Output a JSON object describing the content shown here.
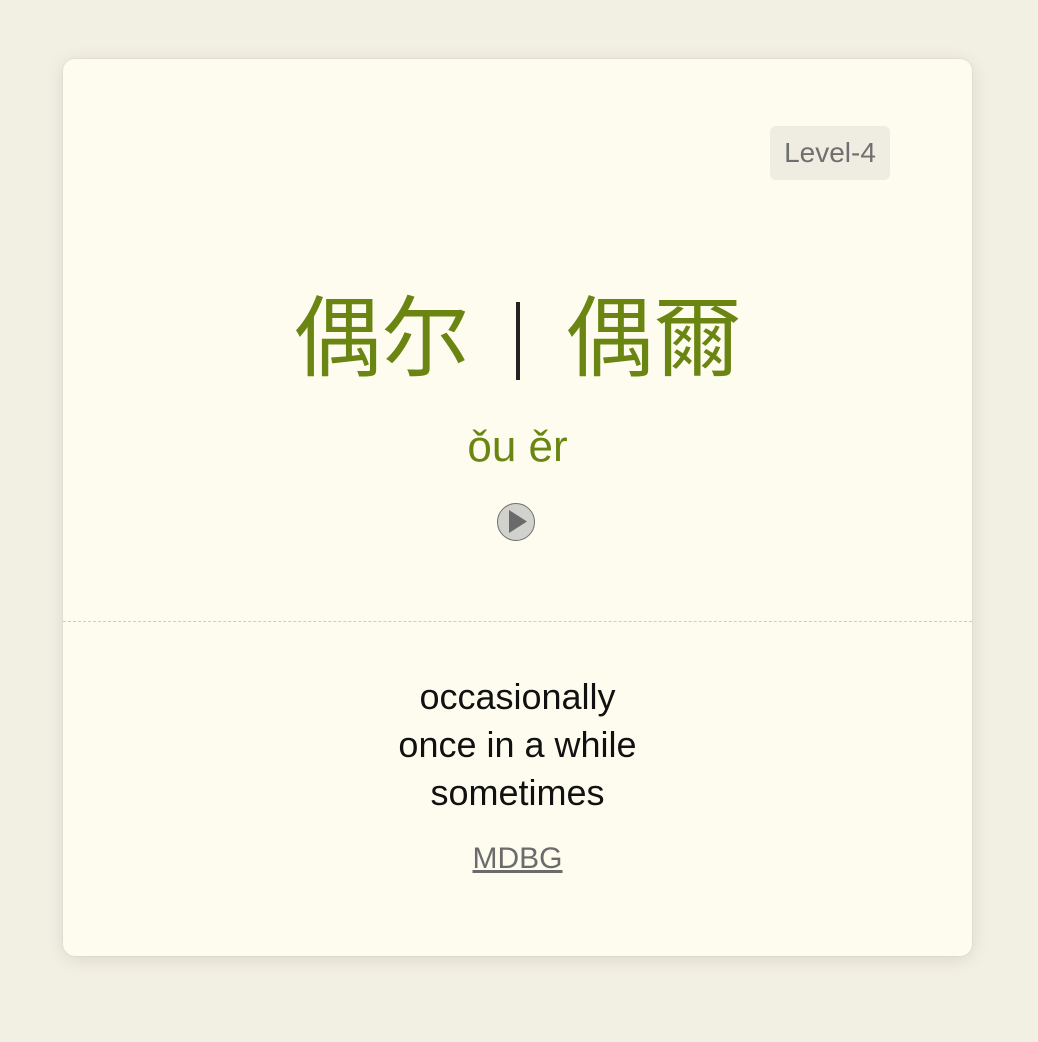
{
  "level_badge": "Level-4",
  "hanzi": {
    "simplified": "偶尔",
    "traditional": "偶爾"
  },
  "pinyin": "ǒu ěr",
  "play_icon": "play-icon",
  "meanings": [
    "occasionally",
    "once in a while",
    "sometimes"
  ],
  "dictionary_link": "MDBG",
  "colors": {
    "background": "#f2efe3",
    "card": "#fefcef",
    "accent_green": "#6b8512",
    "badge_bg": "#efede2"
  }
}
